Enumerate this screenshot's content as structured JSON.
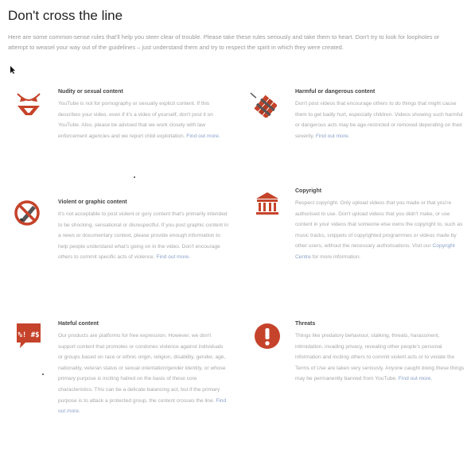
{
  "page": {
    "title": "Don't cross the line",
    "intro": "Here are some common-sense rules that'll help you steer clear of trouble. Please take these rules seriously and take them to heart. Don't try to look for loopholes or attempt to weasel your way out of the guidelines – just understand them and try to respect the spirit in which they were created."
  },
  "accent_color": "#c5432a",
  "link_color": "#8aa2c8",
  "cards": {
    "nudity": {
      "icon": "bikini-icon",
      "title": "Nudity or sexual content",
      "body": "YouTube is not for pornography or sexually explicit content. If this describes your video, even if it's a video of yourself, don't post it on YouTube. Also, please be advised that we work closely with law enforcement agencies and we report child exploitation.",
      "link": "Find out more."
    },
    "harmful": {
      "icon": "dynamite-icon",
      "title": "Harmful or dangerous content",
      "body": "Don't post videos that encourage others to do things that might cause them to get badly hurt, especially children. Videos showing such harmful or dangerous acts may be age-restricted or removed depending on their severity.",
      "link": "Find out more."
    },
    "violent": {
      "icon": "no-knife-icon",
      "title": "Violent or graphic content",
      "body": "It's not acceptable to post violent or gory content that's primarily intended to be shocking, sensational or disrespectful. If you post graphic content in a news or documentary context, please provide enough information to help people understand what's going on in the video. Don't encourage others to commit specific acts of violence.",
      "link": "Find out more."
    },
    "copyright": {
      "icon": "courthouse-icon",
      "title": "Copyright",
      "body_before": "Respect copyright. Only upload videos that you made or that you're authorised to use. Don't upload videos that you didn't make, or use content in your videos that someone else owns the copyright to, such as music tracks, snippets of copyrighted programmes or videos made by other users, without the necessary authorisations. Visit our",
      "link": "Copyright Centre",
      "body_after": "for more information."
    },
    "hateful": {
      "icon": "hate-symbols-icon",
      "icon_text": "%! #$",
      "title": "Hateful content",
      "body": "Our products are platforms for free expression. However, we don't support content that promotes or condones violence against individuals or groups based on race or ethnic origin, religion, disability, gender, age, nationality, veteran status or sexual orientation/gender identity, or whose primary purpose is inciting hatred on the basis of these core characteristics. This can be a delicate balancing act, but if the primary purpose is to attack a protected group, the content crosses the line.",
      "link": "Find out more."
    },
    "threats": {
      "icon": "exclamation-icon",
      "title": "Threats",
      "body": "Things like predatory behaviour, stalking, threats, harassment, intimidation, invading privacy, revealing other people's personal information and inciting others to commit violent acts or to violate the Terms of Use are taken very seriously. Anyone caught doing these things may be permanently banned from YouTube.",
      "link": "Find out more."
    }
  }
}
